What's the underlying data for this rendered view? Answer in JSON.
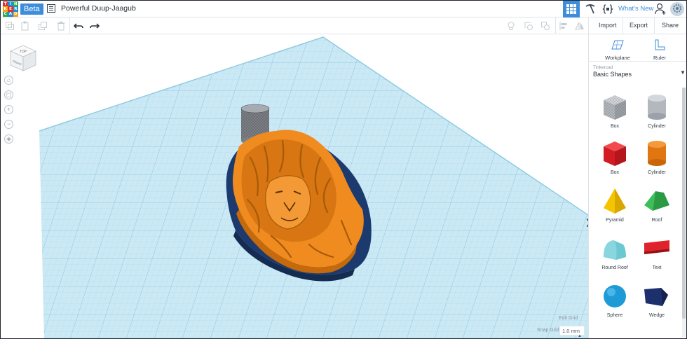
{
  "app": {
    "logo_letters": [
      "T",
      "I",
      "N",
      "K",
      "E",
      "R",
      "C",
      "A",
      "D"
    ],
    "beta_label": "Beta",
    "design_title": "Powerful Duup-Jaagub"
  },
  "topbar": {
    "whats_new": "What's New"
  },
  "toolbar": {
    "import_label": "Import",
    "export_label": "Export",
    "share_label": "Share"
  },
  "viewcube": {
    "top_label": "TOP",
    "front_label": "FRONT"
  },
  "viewport": {
    "edit_grid_label": "Edit Grid",
    "snap_grid_label": "Snap Grid",
    "snap_grid_value": "1.0 mm"
  },
  "panel": {
    "workplane_label": "Workplane",
    "ruler_label": "Ruler",
    "library_caption": "Tinkercad",
    "library_name": "Basic Shapes",
    "shapes": [
      {
        "label": "Box"
      },
      {
        "label": "Cylinder"
      },
      {
        "label": "Box"
      },
      {
        "label": "Cylinder"
      },
      {
        "label": "Pyramid"
      },
      {
        "label": "Roof"
      },
      {
        "label": "Round Roof"
      },
      {
        "label": "Text"
      },
      {
        "label": "Sphere"
      },
      {
        "label": "Wedge"
      }
    ]
  },
  "colors": {
    "accent_blue": "#3d8ddb",
    "grid_blue": "#bfe3f2",
    "model_orange": "#f08b1f",
    "model_navy": "#1c3a6e",
    "shape_red": "#e0222a",
    "shape_yellow": "#f5c400",
    "shape_green": "#2fa84a",
    "shape_teal": "#4fb9c6",
    "shape_sphere": "#1e9bd7",
    "shape_wedge": "#1e2f6e"
  }
}
